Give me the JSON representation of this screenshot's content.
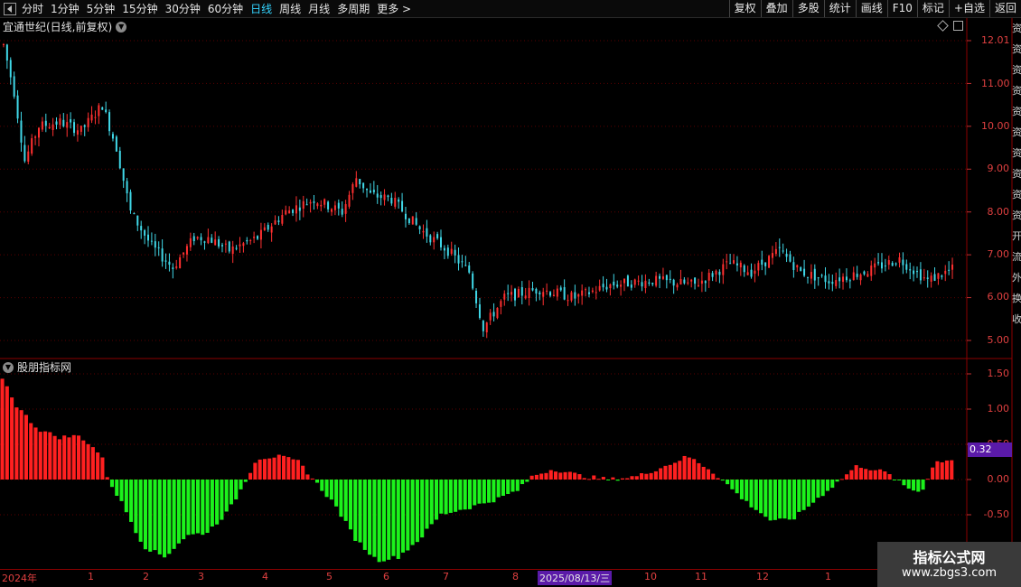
{
  "toolbar": {
    "periods": [
      "分时",
      "1分钟",
      "5分钟",
      "15分钟",
      "30分钟",
      "60分钟",
      "日线",
      "周线",
      "月线",
      "多周期",
      "更多 >"
    ],
    "active_period": "日线",
    "actions": [
      "复权",
      "叠加",
      "多股",
      "统计",
      "画线",
      "F10",
      "标记",
      "+自选",
      "返回"
    ]
  },
  "main_chart": {
    "title": "宜通世纪(日线,前复权)",
    "y_labels": [
      "12.01",
      "11.00",
      "10.00",
      "9.00",
      "8.00",
      "7.00",
      "6.00",
      "5.00"
    ],
    "y_values": [
      12,
      11,
      10,
      9,
      8,
      7,
      6,
      5
    ],
    "up_color": "#ff3030",
    "down_color": "#40d8e8"
  },
  "indicator": {
    "title": "股朋指标网",
    "y_labels": [
      "1.50",
      "1.00",
      "0.50",
      "0.00",
      "-0.50"
    ],
    "y_values": [
      1.5,
      1.0,
      0.5,
      0.0,
      -0.5
    ],
    "current_value": "0.32",
    "pos_color": "#ff2020",
    "neg_color": "#1cf21c"
  },
  "x_axis": {
    "labels": [
      "2024年",
      "1",
      "2",
      "3",
      "4",
      "5",
      "6",
      "7",
      "8",
      "10",
      "11",
      "12",
      "1"
    ],
    "highlight": "2025/08/13/三"
  },
  "right_strip": {
    "chars": [
      "资",
      "资",
      "资",
      "资",
      "资",
      "资",
      "资",
      "资",
      "资",
      "资",
      "开",
      "流",
      "外",
      "换",
      "收"
    ]
  },
  "watermark": {
    "line1": "指标公式网",
    "line2": "www.zbgs3.com"
  }
}
